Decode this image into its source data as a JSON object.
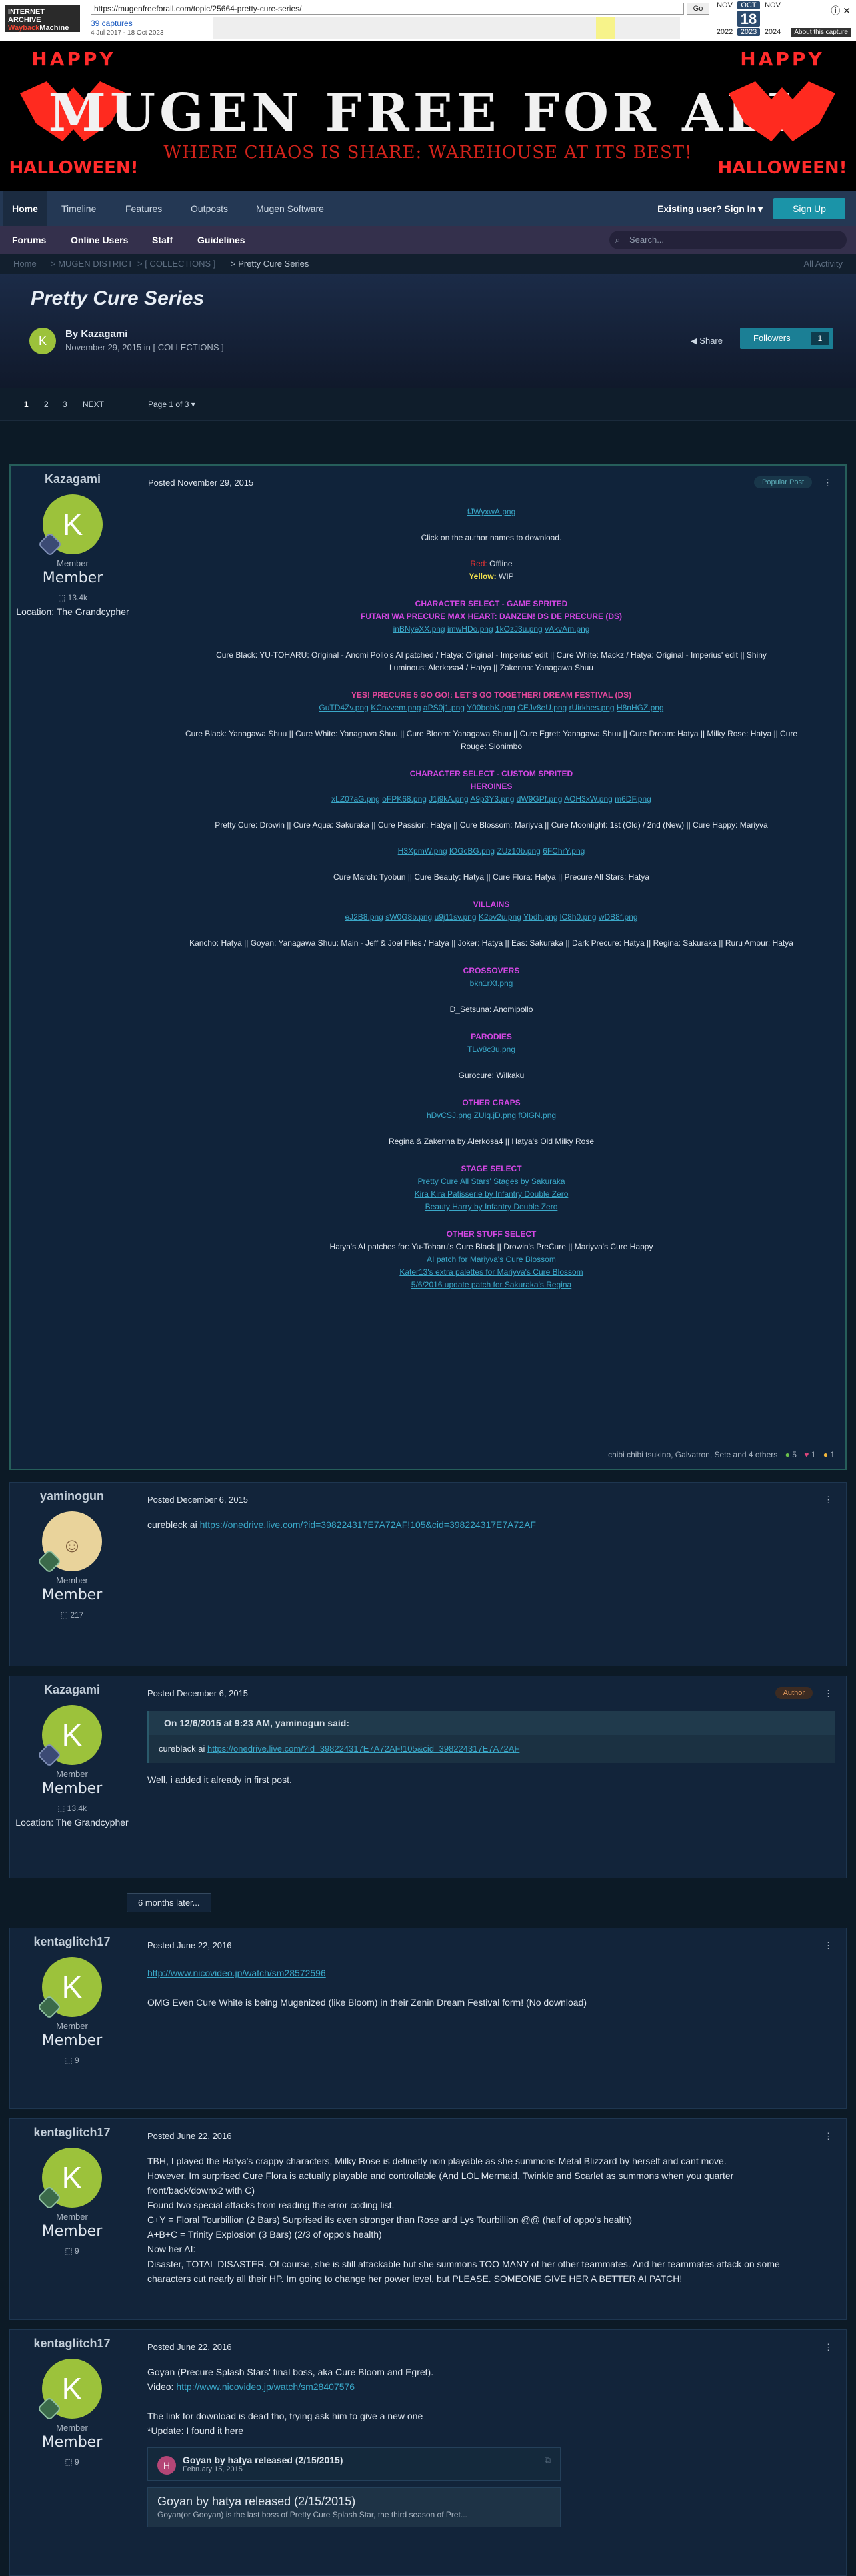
{
  "wayback": {
    "url": "https://mugenfreeforall.com/topic/25664-pretty-cure-series/",
    "go": "Go",
    "captures": "39 captures",
    "range": "4 Jul 2017 - 18 Oct 2023",
    "months": [
      "NOV",
      "OCT",
      "NOV"
    ],
    "day": "18",
    "years": [
      "2022",
      "2023",
      "2024"
    ],
    "tools": [
      "About this capture"
    ]
  },
  "banner": {
    "title": "MUGEN FREE FOR ALL",
    "subtitle": "WHERE CHAOS IS SHARE: WAREHOUSE AT ITS BEST!",
    "happy": "HAPPY",
    "halloween": "HALLOWEEN!"
  },
  "nav": {
    "items": [
      "Home",
      "Timeline",
      "Features",
      "Outposts",
      "Mugen Software"
    ],
    "signin": "Existing user? Sign In ▾",
    "signup": "Sign Up"
  },
  "subnav": {
    "items": [
      "Forums",
      "Online Users",
      "Staff",
      "Guidelines"
    ],
    "search_placeholder": "Search..."
  },
  "breadcrumbs": [
    "Home",
    "> MUGEN DISTRICT",
    "> [ COLLECTIONS ]",
    "> Pretty Cure Series"
  ],
  "all_activity": "All Activity",
  "topic": {
    "title": "Pretty Cure Series",
    "author": "By Kazagami",
    "date": "November 29, 2015 in [ COLLECTIONS ]",
    "share": "Share",
    "followers": "Followers",
    "followers_count": "1"
  },
  "pager": {
    "pages": [
      "1",
      "2",
      "3"
    ],
    "next": "NEXT",
    "label": "Page 1 of 3 ▾"
  },
  "post1": {
    "user": "Kazagami",
    "initial": "K",
    "rank": "Member",
    "rank2": "Member",
    "rep": "13.4k",
    "location": "Location: The Grandcypher",
    "posted": "Posted November 29, 2015",
    "pill": "Popular Post",
    "top_img": "fJWyxwA.png",
    "click_note": "Click on the author names to download.",
    "legend_red": "Red:",
    "legend_red_v": "Offline",
    "legend_yellow": "Yellow:",
    "legend_yellow_v": "WIP",
    "s1": "CHARACTER SELECT - GAME SPRITED",
    "s1b": "FUTARI WA PRECURE MAX HEART: DANZEN! DS DE PRECURE (DS)",
    "s1_imgs": [
      "inBNyeXX.png",
      "imwHDo.png",
      "1kOzJ3u.png",
      "vAkvAm.png"
    ],
    "s1_line1": "Cure Black: YU-TOHARU: Original - Anomi Pollo's AI patched / Hatya: Original - Imperius' edit || Cure White: Mackz / Hatya: Original - Imperius' edit || Shiny",
    "s1_line2": "Luminous: Alerkosa4 / Hatya || Zakenna: Yanagawa Shuu",
    "s2": "YES! PRECURE 5 GO GO!: LET'S GO TOGETHER! DREAM FESTIVAL (DS)",
    "s2_imgs": [
      "GuTD4Zv.png",
      "KCnvvem.png",
      "aPS0j1.png",
      "Y00bobK.png",
      "CEJv8eU.png",
      "rUirkhes.png",
      "H8nHGZ.png"
    ],
    "s2_line1": "Cure Black: Yanagawa Shuu || Cure White: Yanagawa Shuu || Cure Bloom: Yanagawa Shuu || Cure Egret: Yanagawa Shuu || Cure Dream: Hatya || Milky Rose: Hatya || Cure",
    "s2_line2": "Rouge: Slonimbo",
    "s3": "CHARACTER SELECT - CUSTOM SPRITED",
    "s3b": "HEROINES",
    "s3_imgs": [
      "xLZ07aG.png",
      "oFPK68.png",
      "J1j9kA.png",
      "A9p3Y3.png",
      "dW9GPf.png",
      "AOH3xW.png",
      "m6DF.png"
    ],
    "s3_line1": "Pretty Cure: Drowin || Cure Aqua: Sakuraka || Cure Passion: Hatya || Cure Blossom: Mariyva || Cure Moonlight: 1st (Old) / 2nd (New) || Cure Happy: Mariyva",
    "s3_imgs2": [
      "H3XpmW.png",
      "lOGcBG.png",
      "ZUz10b.png",
      "6FChrY.png"
    ],
    "s3_line2": "Cure March: Tyobun || Cure Beauty: Hatya || Cure Flora: Hatya || Precure All Stars: Hatya",
    "s4": "VILLAINS",
    "s4_imgs": [
      "eJ2B8.png",
      "sW0G8b.png",
      "u9j11sv.png",
      "K2ov2u.png",
      "Ybdh.png",
      "lC8h0.png",
      "wDB8f.png"
    ],
    "s4_line1": "Kancho: Hatya || Goyan: Yanagawa Shuu: Main - Jeff & Joel Files / Hatya || Joker: Hatya || Eas: Sakuraka || Dark Precure: Hatya || Regina: Sakuraka || Ruru Amour: Hatya",
    "s5": "CROSSOVERS",
    "s5_img": "bkn1rXf.png",
    "s5_line": "D_Setsuna: Anomipollo",
    "s6": "PARODIES",
    "s6_img": "TLw8c3u.png",
    "s6_line": "Gurocure: Wilkaku",
    "s7": "OTHER CRAPS",
    "s7_imgs": [
      "hDvCSJ.png",
      "ZUlq.jD.png",
      "fOlGN.png"
    ],
    "s7_line": "Regina & Zakenna by Alerkosa4 || Hatya's Old Milky Rose",
    "s8": "STAGE SELECT",
    "s8_lines": [
      "Pretty Cure All Stars' Stages by Sakuraka",
      "Kira Kira Patisserie by Infantry Double Zero",
      "Beauty Harry by Infantry Double Zero"
    ],
    "s9": "OTHER STUFF SELECT",
    "s9_lines": [
      "Hatya's AI patches for: Yu-Toharu's Cure Black || Drowin's PreCure || Mariyva's Cure Happy",
      "AI patch for Mariyva's Cure Blossom",
      "Kater13's extra palettes for Mariyva's Cure Blossom",
      "5/6/2016 update patch for Sakuraka's Regina"
    ],
    "reacts": "chibi chibi tsukino, Galvatron, Sete and 4 others",
    "r_like": "5",
    "r_love": "1",
    "r_haha": "1"
  },
  "post2": {
    "user": "yaminogun",
    "rank": "Member",
    "rank2": "Member",
    "rep": "217",
    "posted": "Posted December 6, 2015",
    "text": "curebleck ai",
    "link": "https://onedrive.live.com/?id=398224317E7A72AF!105&cid=398224317E7A72AF"
  },
  "post3": {
    "user": "Kazagami",
    "initial": "K",
    "rank": "Member",
    "rank2": "Member",
    "rep": "13.4k",
    "location": "Location: The Grandcypher",
    "posted": "Posted December 6, 2015",
    "pill": "Author",
    "quote_head": "On 12/6/2015 at 9:23 AM, yaminogun said:",
    "quote_text": "cureblack ai",
    "quote_link": "https://onedrive.live.com/?id=398224317E7A72AF!105&cid=398224317E7A72AF",
    "text": "Well, i added it already in first post."
  },
  "gap_label": "6 months later...",
  "post4": {
    "user": "kentaglitch17",
    "initial": "K",
    "rank": "Member",
    "rank2": "Member",
    "rep": "9",
    "posted": "Posted June 22, 2016",
    "link": "http://www.nicovideo.jp/watch/sm28572596",
    "text": "OMG Even Cure White is being Mugenized (like Bloom) in their Zenin Dream Festival form! (No download)"
  },
  "post5": {
    "user": "kentaglitch17",
    "initial": "K",
    "rank": "Member",
    "rank2": "Member",
    "rep": "9",
    "posted": "Posted June 22, 2016",
    "lines": [
      "TBH, I played the Hatya's crappy characters, Milky Rose is definetly non playable as she summons Metal Blizzard by herself and cant move.",
      "However, Im surprised Cure Flora is actually playable and controllable (And LOL Mermaid, Twinkle and Scarlet as summons when you quarter",
      "front/back/downx2 with C)",
      "Found two special attacks from reading the error coding list.",
      "C+Y = Floral Tourbillion (2 Bars) Surprised its even stronger than Rose and Lys Tourbillion @@ (half of oppo's health)",
      "A+B+C = Trinity Explosion (3 Bars) (2/3 of oppo's health)",
      "Now her AI:",
      "Disaster, TOTAL DISASTER. Of course, she is still attackable but she summons TOO MANY of her other teammates. And her teammates attack on some",
      "characters cut nearly all their HP. Im going to change her power level, but PLEASE. SOMEONE GIVE HER A BETTER AI PATCH!"
    ]
  },
  "post6": {
    "user": "kentaglitch17",
    "initial": "K",
    "rank": "Member",
    "rank2": "Member",
    "rep": "9",
    "posted": "Posted June 22, 2016",
    "l1": "Goyan (Precure Splash Stars' final boss, aka Cure Bloom and Egret).",
    "l2": "Video:",
    "l2_link": "http://www.nicovideo.jp/watch/sm28407576",
    "l3": "The link for download is dead tho, trying ask him to give a new one",
    "l4": "*Update: I found it here",
    "embed_initial": "H",
    "embed_title": "Goyan by hatya released (2/15/2015)",
    "embed_date": "February 15, 2015",
    "embed2_title": "Goyan by hatya released (2/15/2015)",
    "embed2_text": "Goyan(or Gooyan) is the last boss of Pretty Cure Splash Star, the third season of Pret..."
  },
  "colors": {
    "accent": "#1b94a8",
    "bg": "#0c1a26",
    "heading_pink": "#d447e3"
  }
}
